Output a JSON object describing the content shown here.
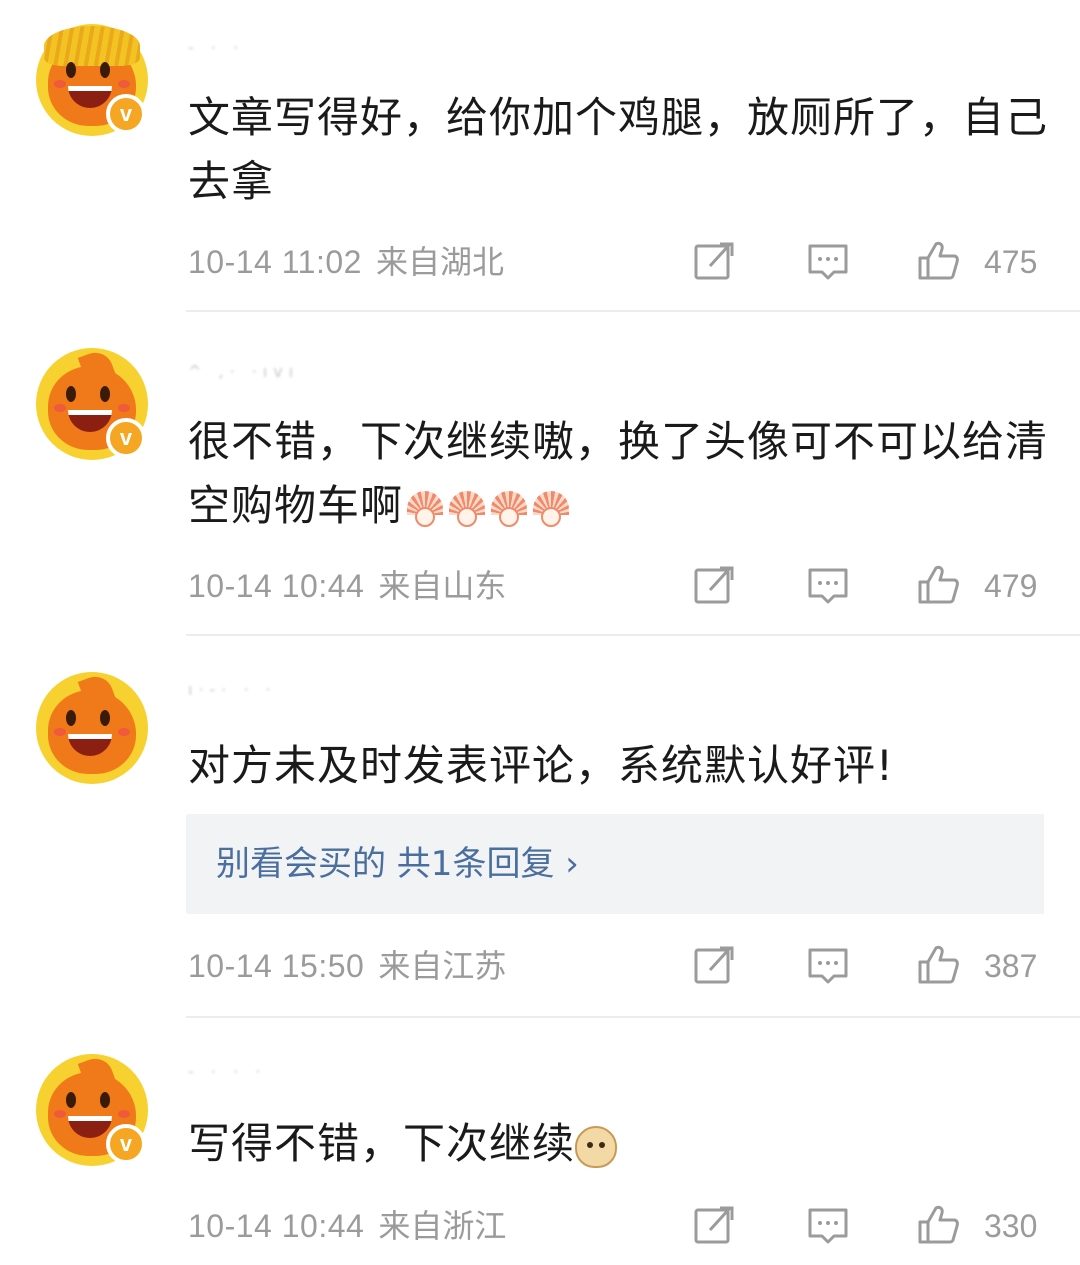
{
  "comments": [
    {
      "text": "文章写得好，给你加个鸡腿，放厕所了，自己去拿",
      "time": "10-14 11:02",
      "location": "来自湖北",
      "likes": "475",
      "avatar": "orange-mascot-golden-hair-avatar",
      "verified": true
    },
    {
      "text": "很不错，下次继续嗷，换了头像可不可以给清空购物车啊",
      "emoji": [
        "emoji-fan-icon",
        "emoji-fan-icon",
        "emoji-fan-icon",
        "emoji-fan-icon"
      ],
      "time": "10-14 10:44",
      "location": "来自山东",
      "likes": "479",
      "avatar": "orange-mascot-avatar",
      "verified": true
    },
    {
      "text": "对方未及时发表评论，系统默认好评!",
      "reply_preview": "别看会买的  共1条回复 ›",
      "time": "10-14 15:50",
      "location": "来自江苏",
      "likes": "387",
      "avatar": "orange-mascot-avatar",
      "verified": false
    },
    {
      "text": "写得不错，下次继续",
      "emoji": [
        "emoji-doge-icon"
      ],
      "time": "10-14 10:44",
      "location": "来自浙江",
      "likes": "330",
      "avatar": "orange-mascot-avatar",
      "verified": true
    }
  ],
  "verified_badge": "v",
  "icons": [
    "share-icon",
    "comment-icon",
    "like-icon"
  ],
  "colors": {
    "text": "#1a1a1a",
    "meta": "#9b9b9b",
    "reply_link": "#4a6f9f",
    "reply_bg": "#f2f3f5",
    "badge": "#f5a623",
    "avatar_bg": "#f6d12f",
    "mascot": "#f07a1a"
  }
}
